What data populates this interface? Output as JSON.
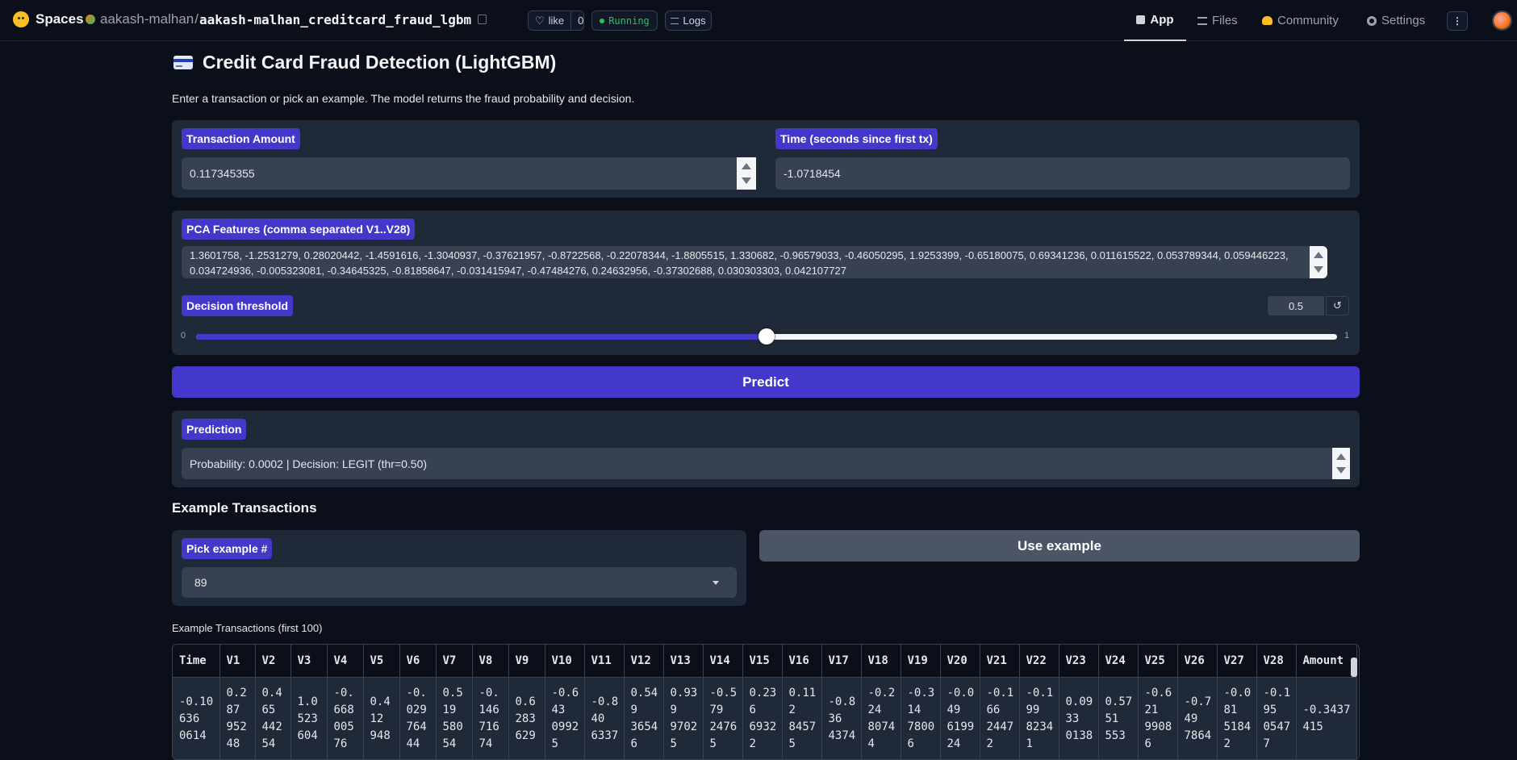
{
  "header": {
    "brand": "Spaces",
    "owner": "aakash-malhan",
    "repo": "aakash-malhan_creditcard_fraud_lgbm",
    "like_label": "like",
    "like_count": "0",
    "status": "Running",
    "logs": "Logs",
    "nav": {
      "app": "App",
      "files": "Files",
      "community": "Community",
      "settings": "Settings"
    }
  },
  "page": {
    "title": "Credit Card Fraud Detection (LightGBM)",
    "subtitle": "Enter a transaction or pick an example. The model returns the fraud probability and decision."
  },
  "inputs": {
    "amount_label": "Transaction Amount",
    "amount_value": "0.117345355",
    "time_label": "Time (seconds since first tx)",
    "time_value": "-1.0718454",
    "pca_label": "PCA Features (comma separated V1..V28)",
    "pca_value": "1.3601758, -1.2531279, 0.28020442, -1.4591616, -1.3040937, -0.37621957, -0.8722568, -0.22078344, -1.8805515, 1.330682, -0.96579033, -0.46050295, 1.9253399, -0.65180075, 0.69341236, 0.011615522, 0.053789344, 0.059446223, 0.034724936, -0.005323081, -0.34645325, -0.81858647, -0.031415947, -0.47484276, 0.24632956, -0.37302688, 0.030303303, 0.042107727",
    "threshold_label": "Decision threshold",
    "threshold_value": "0.5",
    "threshold_fraction": 0.5,
    "slider_min": "0",
    "slider_max": "1",
    "reset_icon": "↺"
  },
  "predict_label": "Predict",
  "prediction": {
    "label": "Prediction",
    "value": "Probability: 0.0002  |  Decision: LEGIT (thr=0.50)"
  },
  "examples": {
    "heading": "Example Transactions",
    "pick_label": "Pick example #",
    "pick_value": "89",
    "use_label": "Use example",
    "table_caption": "Example Transactions (first 100)",
    "columns": [
      "Time",
      "V1",
      "V2",
      "V3",
      "V4",
      "V5",
      "V6",
      "V7",
      "V8",
      "V9",
      "V10",
      "V11",
      "V12",
      "V13",
      "V14",
      "V15",
      "V16",
      "V17",
      "V18",
      "V19",
      "V20",
      "V21",
      "V22",
      "V23",
      "V24",
      "V25",
      "V26",
      "V27",
      "V28",
      "Amount"
    ],
    "rows": [
      [
        "-0.10636 0614",
        "0.287 95248",
        "0.465 44254",
        "1.0523 604",
        "-0.668 00576",
        "0.412 948",
        "-0.029 76444",
        "0.519 58054",
        "-0.146 71674",
        "0.6283 629",
        "-0.643 09925",
        "-0.840 6337",
        "0.549 36546",
        "0.939 97025",
        "-0.579 24765",
        "0.236 69322",
        "0.112 84575",
        "-0.836 4374",
        "-0.224 80744",
        "-0.314 78006",
        "-0.049 619924",
        "-0.166 24472",
        "-0.199 82341",
        "0.0933 0138",
        "0.5751 553",
        "-0.621 99086",
        "-0.749 7864",
        "-0.081 51842",
        "-0.195 05477",
        "-0.3437 415"
      ]
    ]
  },
  "colors": {
    "accent": "#4338ca",
    "bg": "#0b0f19",
    "panel": "#1f2937",
    "field": "#374151",
    "running": "#22c55e"
  }
}
